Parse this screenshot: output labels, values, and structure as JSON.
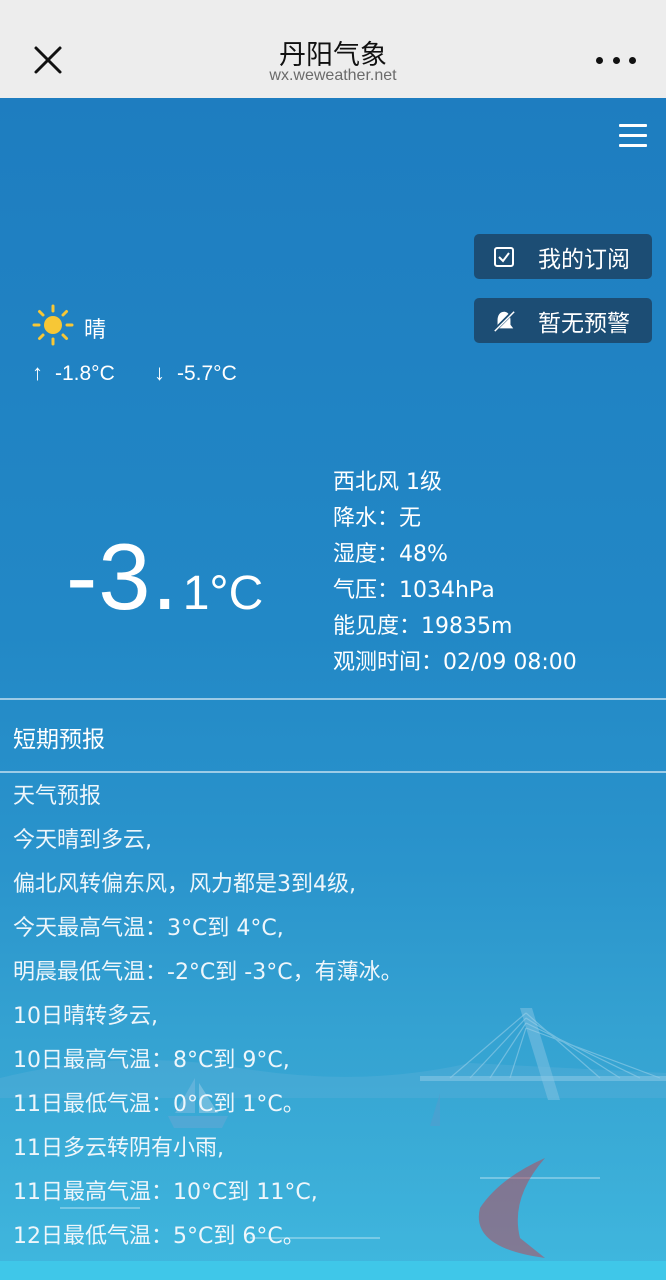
{
  "header": {
    "title": "丹阳气象",
    "url": "wx.weweather.net"
  },
  "buttons": {
    "subscribe_label": "我的订阅",
    "warning_label": "暂无预警"
  },
  "current": {
    "weather": "晴",
    "high": "-1.8°C",
    "low": "-5.7°C",
    "temp_int": "-3.",
    "temp_dec": "1°C",
    "details": [
      "西北风 1级",
      "降水：无",
      "湿度：48%",
      "气压：1034hPa",
      "能见度：19835m",
      "观测时间：02/09 08:00"
    ]
  },
  "section": {
    "title": "短期预报"
  },
  "forecast": {
    "lines": [
      "天气预报",
      "今天晴到多云,",
      "偏北风转偏东风，风力都是3到4级,",
      "今天最高气温：3°C到 4°C,",
      "明晨最低气温：-2°C到 -3°C，有薄冰。",
      "10日晴转多云,",
      "10日最高气温：8°C到 9°C,",
      "11日最低气温：0°C到 1°C。",
      "11日多云转阴有小雨,",
      "11日最高气温：10°C到 11°C,",
      "12日最低气温：5°C到 6°C。"
    ]
  },
  "icons": {
    "close": "close-icon",
    "more": "more-icon",
    "menu": "menu-icon",
    "subscribe": "bookmark-check-icon",
    "warning": "bell-off-icon",
    "weather": "sun-icon"
  },
  "colors": {
    "navbar": "#ededed",
    "background": "#1f7fbf",
    "pill": "#1c4d74",
    "text": "#ffffff"
  }
}
